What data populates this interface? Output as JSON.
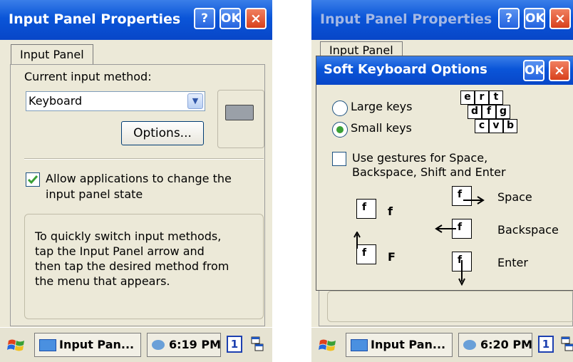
{
  "left": {
    "title": "Input Panel Properties",
    "help_label": "?",
    "ok_label": "OK",
    "close_label": "×",
    "tab_label": "Input Panel",
    "current_method_label": "Current input method:",
    "current_method_value": "Keyboard",
    "options_label": "Options...",
    "allow_label_1": "Allow applications to change the",
    "allow_label_2": "input panel state",
    "allow_checked": true,
    "info_lines": [
      "To quickly switch input methods,",
      "tap the Input Panel arrow and",
      "then tap the desired method from",
      "the menu that appears."
    ],
    "taskbar": {
      "task_label": "Input Pan...",
      "time": "6:19 PM",
      "sip_label": "1"
    }
  },
  "right": {
    "title": "Input Panel Properties",
    "help_label": "?",
    "ok_label": "OK",
    "close_label": "×",
    "tab_label": "Input Panel",
    "dialog": {
      "title": "Soft Keyboard Options",
      "ok_label": "OK",
      "close_label": "×",
      "large_keys_label": "Large keys",
      "small_keys_label": "Small keys",
      "selected": "small",
      "key_rows": [
        [
          "e",
          "r",
          "t"
        ],
        [
          "d",
          "f",
          "g"
        ],
        [
          "c",
          "v",
          "b"
        ]
      ],
      "gestures_label_1": "Use gestures for Space,",
      "gestures_label_2": "Backspace, Shift and Enter",
      "gestures_checked": false,
      "gesture_items": [
        {
          "glyph": "f",
          "label": "f"
        },
        {
          "glyph": "f",
          "label": "F"
        },
        {
          "glyph": "f",
          "label": "Space"
        },
        {
          "glyph": "f",
          "label": "Backspace"
        },
        {
          "glyph": "f",
          "label": "Enter"
        }
      ]
    },
    "taskbar": {
      "task_label": "Input Pan...",
      "time": "6:20 PM",
      "sip_label": "1"
    }
  },
  "colors": {
    "titlebar": "#0a55d8",
    "face": "#ece9d8",
    "check_green": "#3aa035"
  }
}
